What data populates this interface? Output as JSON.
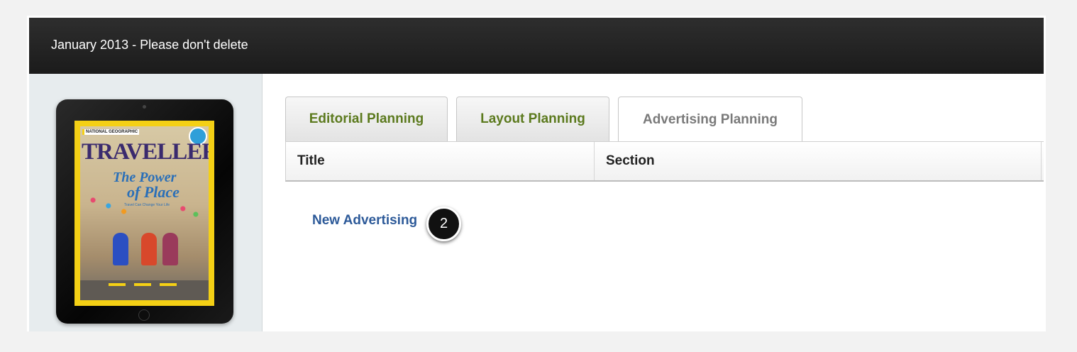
{
  "header": {
    "title": "January 2013 - Please don't delete"
  },
  "sidebar": {
    "cover_image": {
      "masthead": "TRAVELLER",
      "brand": "NATIONAL GEOGRAPHIC",
      "headline_1": "The Power",
      "headline_2": "of Place",
      "subheadline": "Travel Can Change Your Life"
    }
  },
  "tabs": [
    {
      "label": "Editorial Planning",
      "active": false
    },
    {
      "label": "Layout Planning",
      "active": false
    },
    {
      "label": "Advertising Planning",
      "active": true
    }
  ],
  "table": {
    "columns": [
      "Title",
      "Section"
    ]
  },
  "actions": {
    "new_advertising": "New Advertising"
  },
  "annotation": {
    "step_number": "2"
  },
  "colors": {
    "header_bg": "#222222",
    "tab_text": "#5c7a1e",
    "active_tab_text": "#7a7a7a",
    "link": "#2d5a99",
    "sidebar_bg": "#e7ecee",
    "cover_border": "#f4d015"
  }
}
